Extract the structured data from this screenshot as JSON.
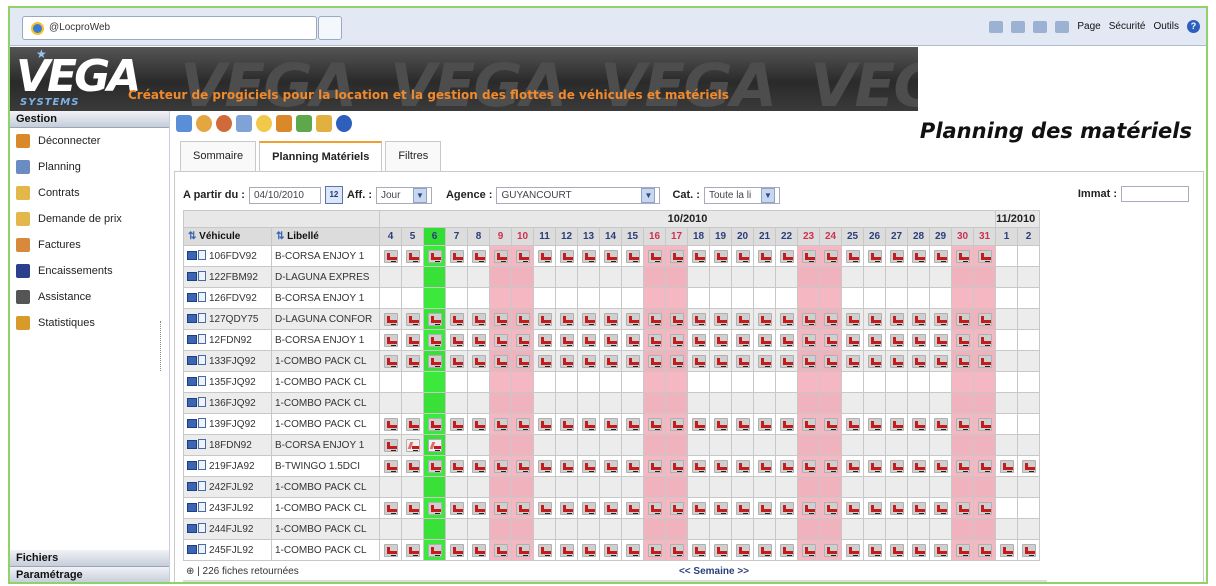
{
  "browser": {
    "tab_title": "@LocproWeb",
    "toolbar": [
      "Page",
      "Sécurité",
      "Outils"
    ]
  },
  "banner": {
    "logo": "VEGA",
    "logo_sub": "SYSTEMS",
    "tagline": "Créateur de progiciels pour la location et la gestion des flottes de véhicules et matériels"
  },
  "sidebar": {
    "header": "Gestion",
    "items": [
      {
        "label": "Déconnecter",
        "icon": "users-icon",
        "color": "#d9892a"
      },
      {
        "label": "Planning",
        "icon": "calendar-icon",
        "color": "#6b8cc2"
      },
      {
        "label": "Contrats",
        "icon": "contract-icon",
        "color": "#e3b74a"
      },
      {
        "label": "Demande de prix",
        "icon": "price-request-icon",
        "color": "#e3b74a"
      },
      {
        "label": "Factures",
        "icon": "invoice-icon",
        "color": "#d88a3a"
      },
      {
        "label": "Encaissements",
        "icon": "dollar-icon",
        "color": "#2b3f8c"
      },
      {
        "label": "Assistance",
        "icon": "tools-icon",
        "color": "#555"
      },
      {
        "label": "Statistiques",
        "icon": "chart-icon",
        "color": "#d89a2a"
      }
    ],
    "bottom": [
      "Fichiers",
      "Paramétrage"
    ]
  },
  "page_title": "Planning des matériels",
  "tabs": [
    "Sommaire",
    "Planning Matériels",
    "Filtres"
  ],
  "active_tab": 1,
  "filters": {
    "from_label": "A partir du :",
    "from_value": "04/10/2010",
    "calendar": "12",
    "aff_label": "Aff. :",
    "aff_value": "Jour",
    "agence_label": "Agence :",
    "agence_value": "GUYANCOURT",
    "cat_label": "Cat. :",
    "cat_value": "Toute la li",
    "immat_label": "Immat :",
    "immat_value": ""
  },
  "grid": {
    "col_vehicule": "Véhicule",
    "col_libelle": "Libellé",
    "months": [
      {
        "label": "10/2010",
        "span": 28
      },
      {
        "label": "11/2010",
        "span": 2
      }
    ],
    "days": [
      "4",
      "5",
      "6",
      "7",
      "8",
      "9",
      "10",
      "11",
      "12",
      "13",
      "14",
      "15",
      "16",
      "17",
      "18",
      "19",
      "20",
      "21",
      "22",
      "23",
      "24",
      "25",
      "26",
      "27",
      "28",
      "29",
      "30",
      "31",
      "1",
      "2"
    ],
    "weekend_days": [
      5,
      6,
      12,
      13,
      19,
      20,
      26,
      27
    ],
    "today_index": 2,
    "rows": [
      {
        "vehicule": "106FDV92",
        "libelle": "B-CORSA ENJOY 1",
        "book": [
          0,
          27
        ]
      },
      {
        "vehicule": "122FBM92",
        "libelle": "D-LAGUNA EXPRES",
        "book": null
      },
      {
        "vehicule": "126FDV92",
        "libelle": "B-CORSA ENJOY 1",
        "book": null
      },
      {
        "vehicule": "127QDY75",
        "libelle": "D-LAGUNA CONFOR",
        "book": [
          0,
          27
        ]
      },
      {
        "vehicule": "12FDN92",
        "libelle": "B-CORSA ENJOY 1",
        "book": [
          0,
          27
        ]
      },
      {
        "vehicule": "133FJQ92",
        "libelle": "1-COMBO PACK CL",
        "book": [
          0,
          27
        ]
      },
      {
        "vehicule": "135FJQ92",
        "libelle": "1-COMBO PACK CL",
        "book": null
      },
      {
        "vehicule": "136FJQ92",
        "libelle": "1-COMBO PACK CL",
        "book": null
      },
      {
        "vehicule": "139FJQ92",
        "libelle": "1-COMBO PACK CL",
        "book": [
          0,
          27
        ]
      },
      {
        "vehicule": "18FDN92",
        "libelle": "B-CORSA ENJOY 1",
        "book": [
          0,
          2
        ],
        "partial": [
          1,
          2
        ]
      },
      {
        "vehicule": "219FJA92",
        "libelle": "B-TWINGO 1.5DCI",
        "book": [
          0,
          29
        ]
      },
      {
        "vehicule": "242FJL92",
        "libelle": "1-COMBO PACK CL",
        "book": null
      },
      {
        "vehicule": "243FJL92",
        "libelle": "1-COMBO PACK CL",
        "book": [
          0,
          27
        ]
      },
      {
        "vehicule": "244FJL92",
        "libelle": "1-COMBO PACK CL",
        "book": null
      },
      {
        "vehicule": "245FJL92",
        "libelle": "1-COMBO PACK CL",
        "book": [
          0,
          29
        ]
      }
    ],
    "footer_count": "| 226 fiches retournées",
    "footer_nav": "<< Semaine >>"
  }
}
